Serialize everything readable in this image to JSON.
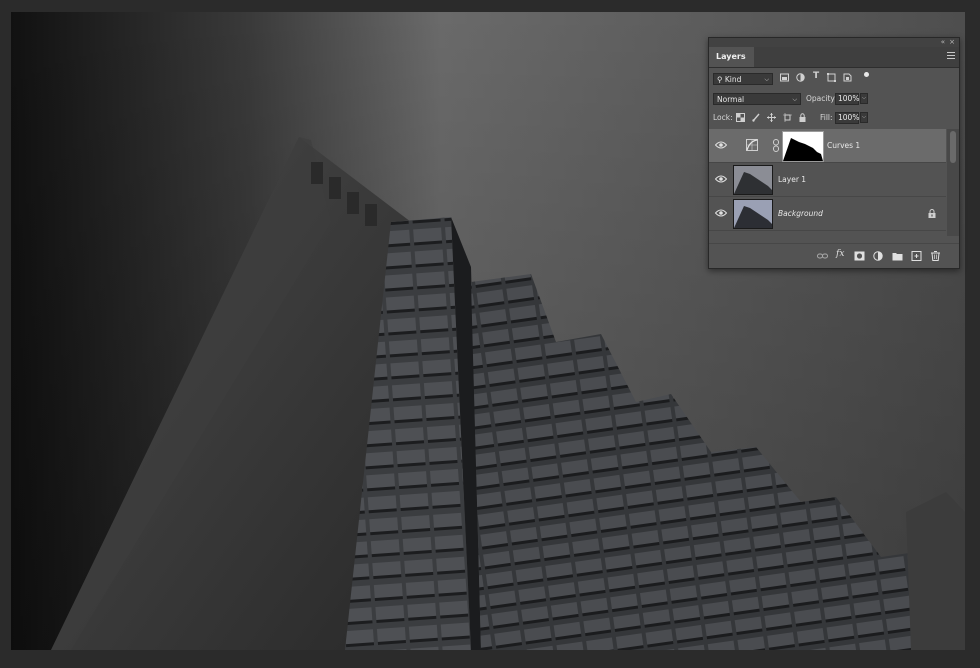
{
  "panel": {
    "tab_label": "Layers",
    "filter_kind": "Kind",
    "blend_mode": "Normal",
    "opacity_label": "Opacity:",
    "opacity_value": "100%",
    "lock_label": "Lock:",
    "fill_label": "Fill:",
    "fill_value": "100%"
  },
  "layers": [
    {
      "name": "Curves 1",
      "selected": true,
      "visible": true
    },
    {
      "name": "Layer 1",
      "selected": false,
      "visible": true
    },
    {
      "name": "Background",
      "selected": false,
      "visible": true,
      "locked": true
    }
  ],
  "colors": {
    "canvas_sky": "#6a6a6a",
    "building_dark": "#2d2f31",
    "panel_bg": "#535353",
    "selected_row": "#6b6b6b"
  }
}
